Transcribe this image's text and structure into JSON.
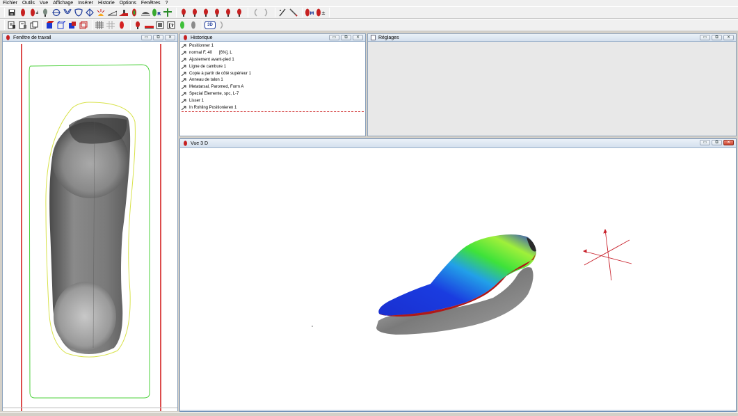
{
  "menubar": {
    "items": [
      "Fichier",
      "Outils",
      "Vue",
      "Affichage",
      "Insérer",
      "Historie",
      "Options",
      "Fenêtres",
      "?"
    ]
  },
  "toolbar1": {
    "icons": [
      "save-icon",
      "foot-red-icon",
      "foot-plus-icon",
      "foot-gray-icon",
      "crosshair-icon",
      "heel-cup-icon",
      "shield-icon",
      "diamond-icon",
      "sun-rays-icon",
      "slope-icon",
      "ramp-red-icon",
      "foot-outline-icon",
      "layers-icon",
      "foot-green-R-icon",
      "green-plus-icon",
      "foot-red-1-icon",
      "foot-red-2-icon",
      "foot-red-3-icon",
      "foot-red-4-icon",
      "foot-red-5-icon",
      "foot-red-6-icon",
      "undo-icon",
      "redo-icon",
      "pen-icon",
      "pencil-icon",
      "foot-M-icon",
      "foot-pm-icon"
    ]
  },
  "toolbar2": {
    "icons": [
      "doc-icon",
      "doc-scan-icon",
      "copy-icon",
      "cube-blue-icon",
      "cube-outline-icon",
      "cube-red-icon",
      "cube-wire-icon",
      "grid-icon",
      "grid-dots-icon",
      "foot-red-icon",
      "foot-small-icon",
      "red-bar-icon",
      "square-icon",
      "bracket-icon",
      "green-foot-icon",
      "gray-foot-icon",
      "3d-icon",
      "gray-curve-icon"
    ],
    "label_3d": "3D"
  },
  "work_window": {
    "title": "Fenêtre de travail"
  },
  "history_window": {
    "title": "Historique",
    "items": [
      "Positionner 1",
      "normal F, 40      [6%], L",
      "Ajustement avant-pied 1",
      "Ligne de cambure 1",
      "Copie à partir de côté supérieur 1",
      "Anneau de talon 1",
      "Metatarsal, Paromed, Form A",
      "Spezial Elemente, spc, L-7",
      "Lisser 1",
      "In Rohling Positionieren 1"
    ]
  },
  "settings_window": {
    "title": "Réglages"
  },
  "view3d_window": {
    "title": "Vue 3 D"
  },
  "colors": {
    "accent_red": "#d42020",
    "outline_green": "#4bd03a",
    "outline_yellow": "#d8e24a",
    "insole_blue": "#1c3cd8",
    "insole_green": "#3fe23a"
  }
}
